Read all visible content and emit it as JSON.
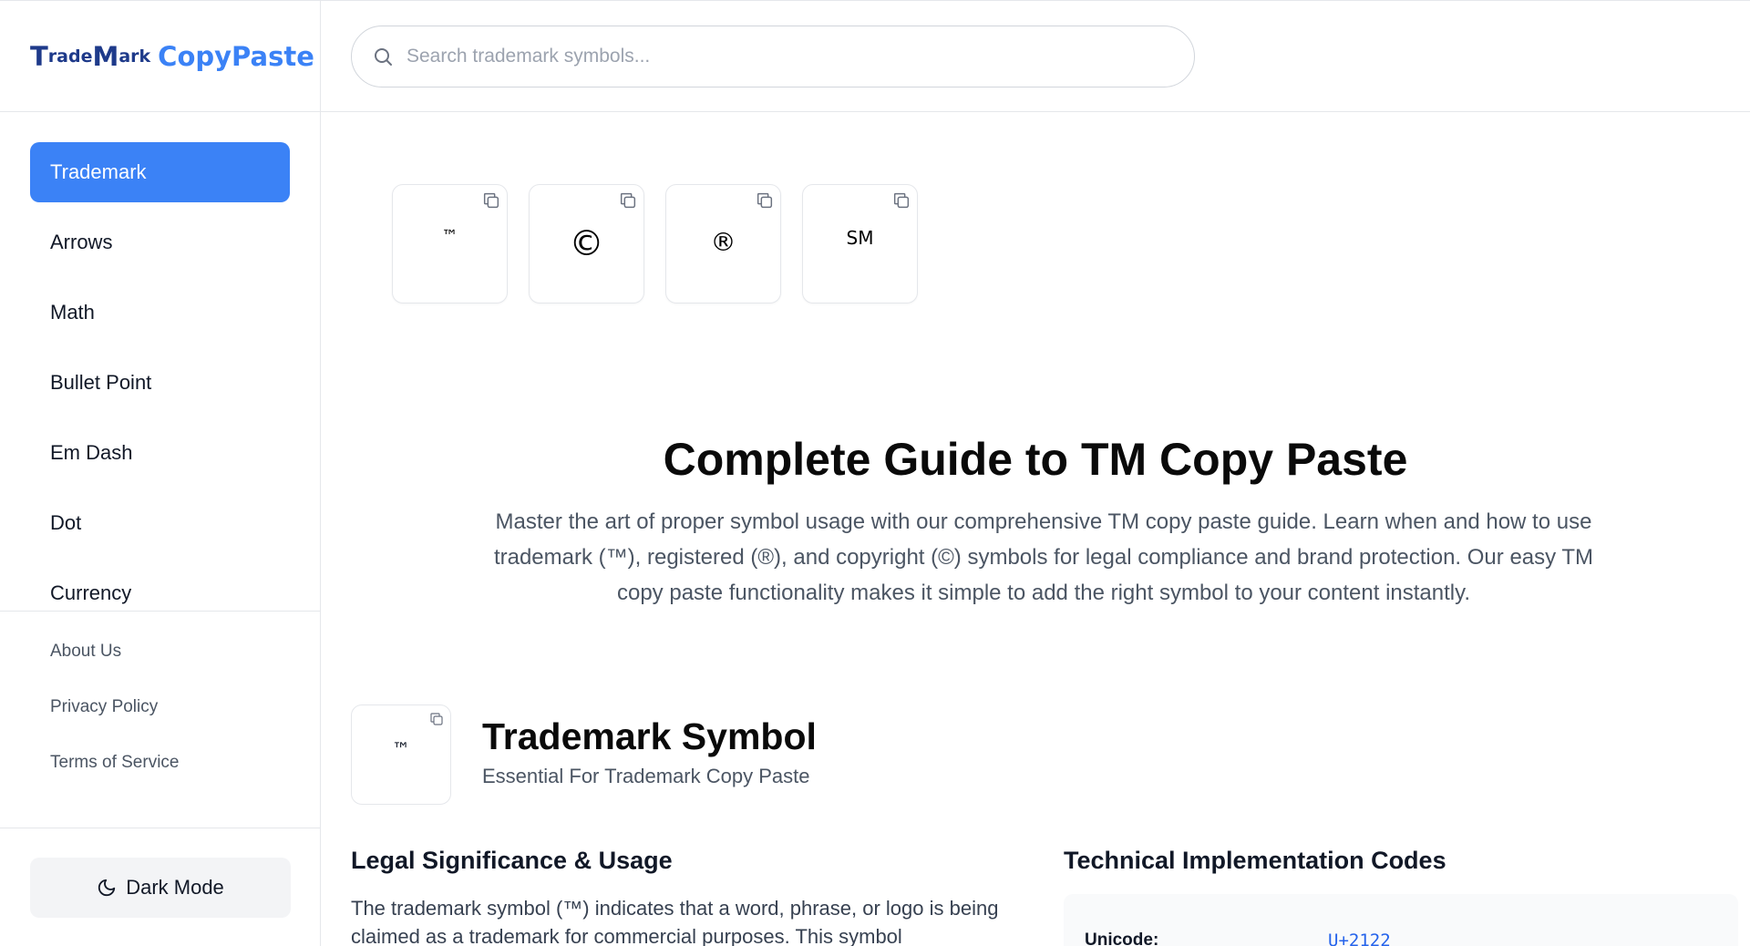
{
  "brand": {
    "part1": "T",
    "part2": "rade",
    "part3": "M",
    "part4": "ark",
    "part5": "CopyPaste"
  },
  "search": {
    "placeholder": "Search trademark symbols..."
  },
  "sidebar": {
    "items": [
      {
        "label": "Trademark",
        "active": true
      },
      {
        "label": "Arrows"
      },
      {
        "label": "Math"
      },
      {
        "label": "Bullet Point"
      },
      {
        "label": "Em Dash"
      },
      {
        "label": "Dot"
      },
      {
        "label": "Currency"
      }
    ],
    "links": [
      "About Us",
      "Privacy Policy",
      "Terms of Service"
    ],
    "dark_mode_label": "Dark Mode"
  },
  "symbols": [
    "™",
    "©",
    "®",
    "SM"
  ],
  "guide": {
    "title": "Complete Guide to TM Copy Paste",
    "description": "Master the art of proper symbol usage with our comprehensive TM copy paste guide. Learn when and how to use trademark (™), registered (®), and copyright (©) symbols for legal compliance and brand protection. Our easy TM copy paste functionality makes it simple to add the right symbol to your content instantly."
  },
  "trademark_section": {
    "symbol": "™",
    "title": "Trademark Symbol",
    "subtitle": "Essential For Trademark Copy Paste",
    "legal_heading": "Legal Significance & Usage",
    "legal_text": "The trademark symbol (™) indicates that a word, phrase, or logo is being claimed as a trademark for commercial purposes. This symbol",
    "codes_heading": "Technical Implementation Codes",
    "codes": [
      {
        "label": "Unicode:",
        "value": "U+2122"
      }
    ]
  },
  "colors": {
    "accent": "#3b82f6",
    "brand_dark": "#1e3a8a"
  }
}
